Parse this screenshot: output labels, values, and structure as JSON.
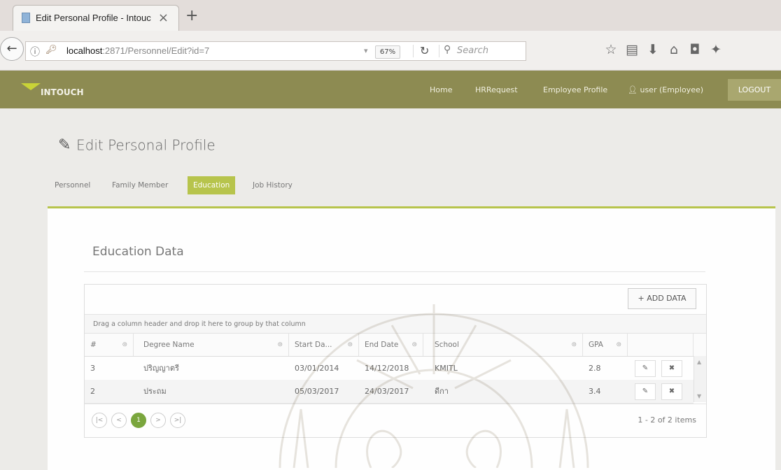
{
  "browser": {
    "tab_title": "Edit Personal Profile - Intouc",
    "new_tab": "+",
    "url_host": "localhost",
    "url_rest": ":2871/Personnel/Edit?id=7",
    "zoom": "67%",
    "search_placeholder": "Search"
  },
  "app": {
    "logo": "INTOUCH",
    "nav": {
      "home": "Home",
      "hrrequest": "HRRequest",
      "employee_profile": "Employee Profile",
      "user": "user (Employee)",
      "logout": "LOGOUT"
    }
  },
  "page": {
    "title": "Edit Personal Profile",
    "tabs": [
      "Personnel",
      "Family Member",
      "Education",
      "Job History"
    ],
    "active_tab": "Education"
  },
  "education": {
    "title": "Education Data",
    "add_button": "+ ADD DATA",
    "group_hint": "Drag a column header and drop it here to group by that column",
    "columns": [
      "#",
      "Degree Name",
      "Start Da...",
      "End Date",
      "School",
      "GPA"
    ],
    "rows": [
      {
        "id": "3",
        "degree": "ปริญญาตรี",
        "start": "03/01/2014",
        "end": "14/12/2018",
        "school": "KMITL",
        "gpa": "2.8"
      },
      {
        "id": "2",
        "degree": "ประถม",
        "start": "05/03/2017",
        "end": "24/03/2017",
        "school": "ดีกา",
        "gpa": "3.4"
      }
    ],
    "pager": {
      "first": "|<",
      "prev": "<",
      "current": "1",
      "next": ">",
      "last": ">|",
      "info": "1 - 2 of 2 items"
    }
  },
  "icons": {
    "back": "arrow-left-icon",
    "info": "info-icon",
    "key": "key-icon",
    "reload": "reload-icon",
    "search": "search-icon",
    "bookmark": "star-icon",
    "reader": "clipboard-icon",
    "download": "download-icon",
    "home": "home-icon",
    "pocket": "pocket-icon",
    "edit": "pencil-icon",
    "delete": "x-icon",
    "user": "user-icon",
    "filter": "filter-icon"
  },
  "colors": {
    "appbar": "#8d8b52",
    "accent": "#b7c44c",
    "pager_current": "#7aa63d"
  }
}
